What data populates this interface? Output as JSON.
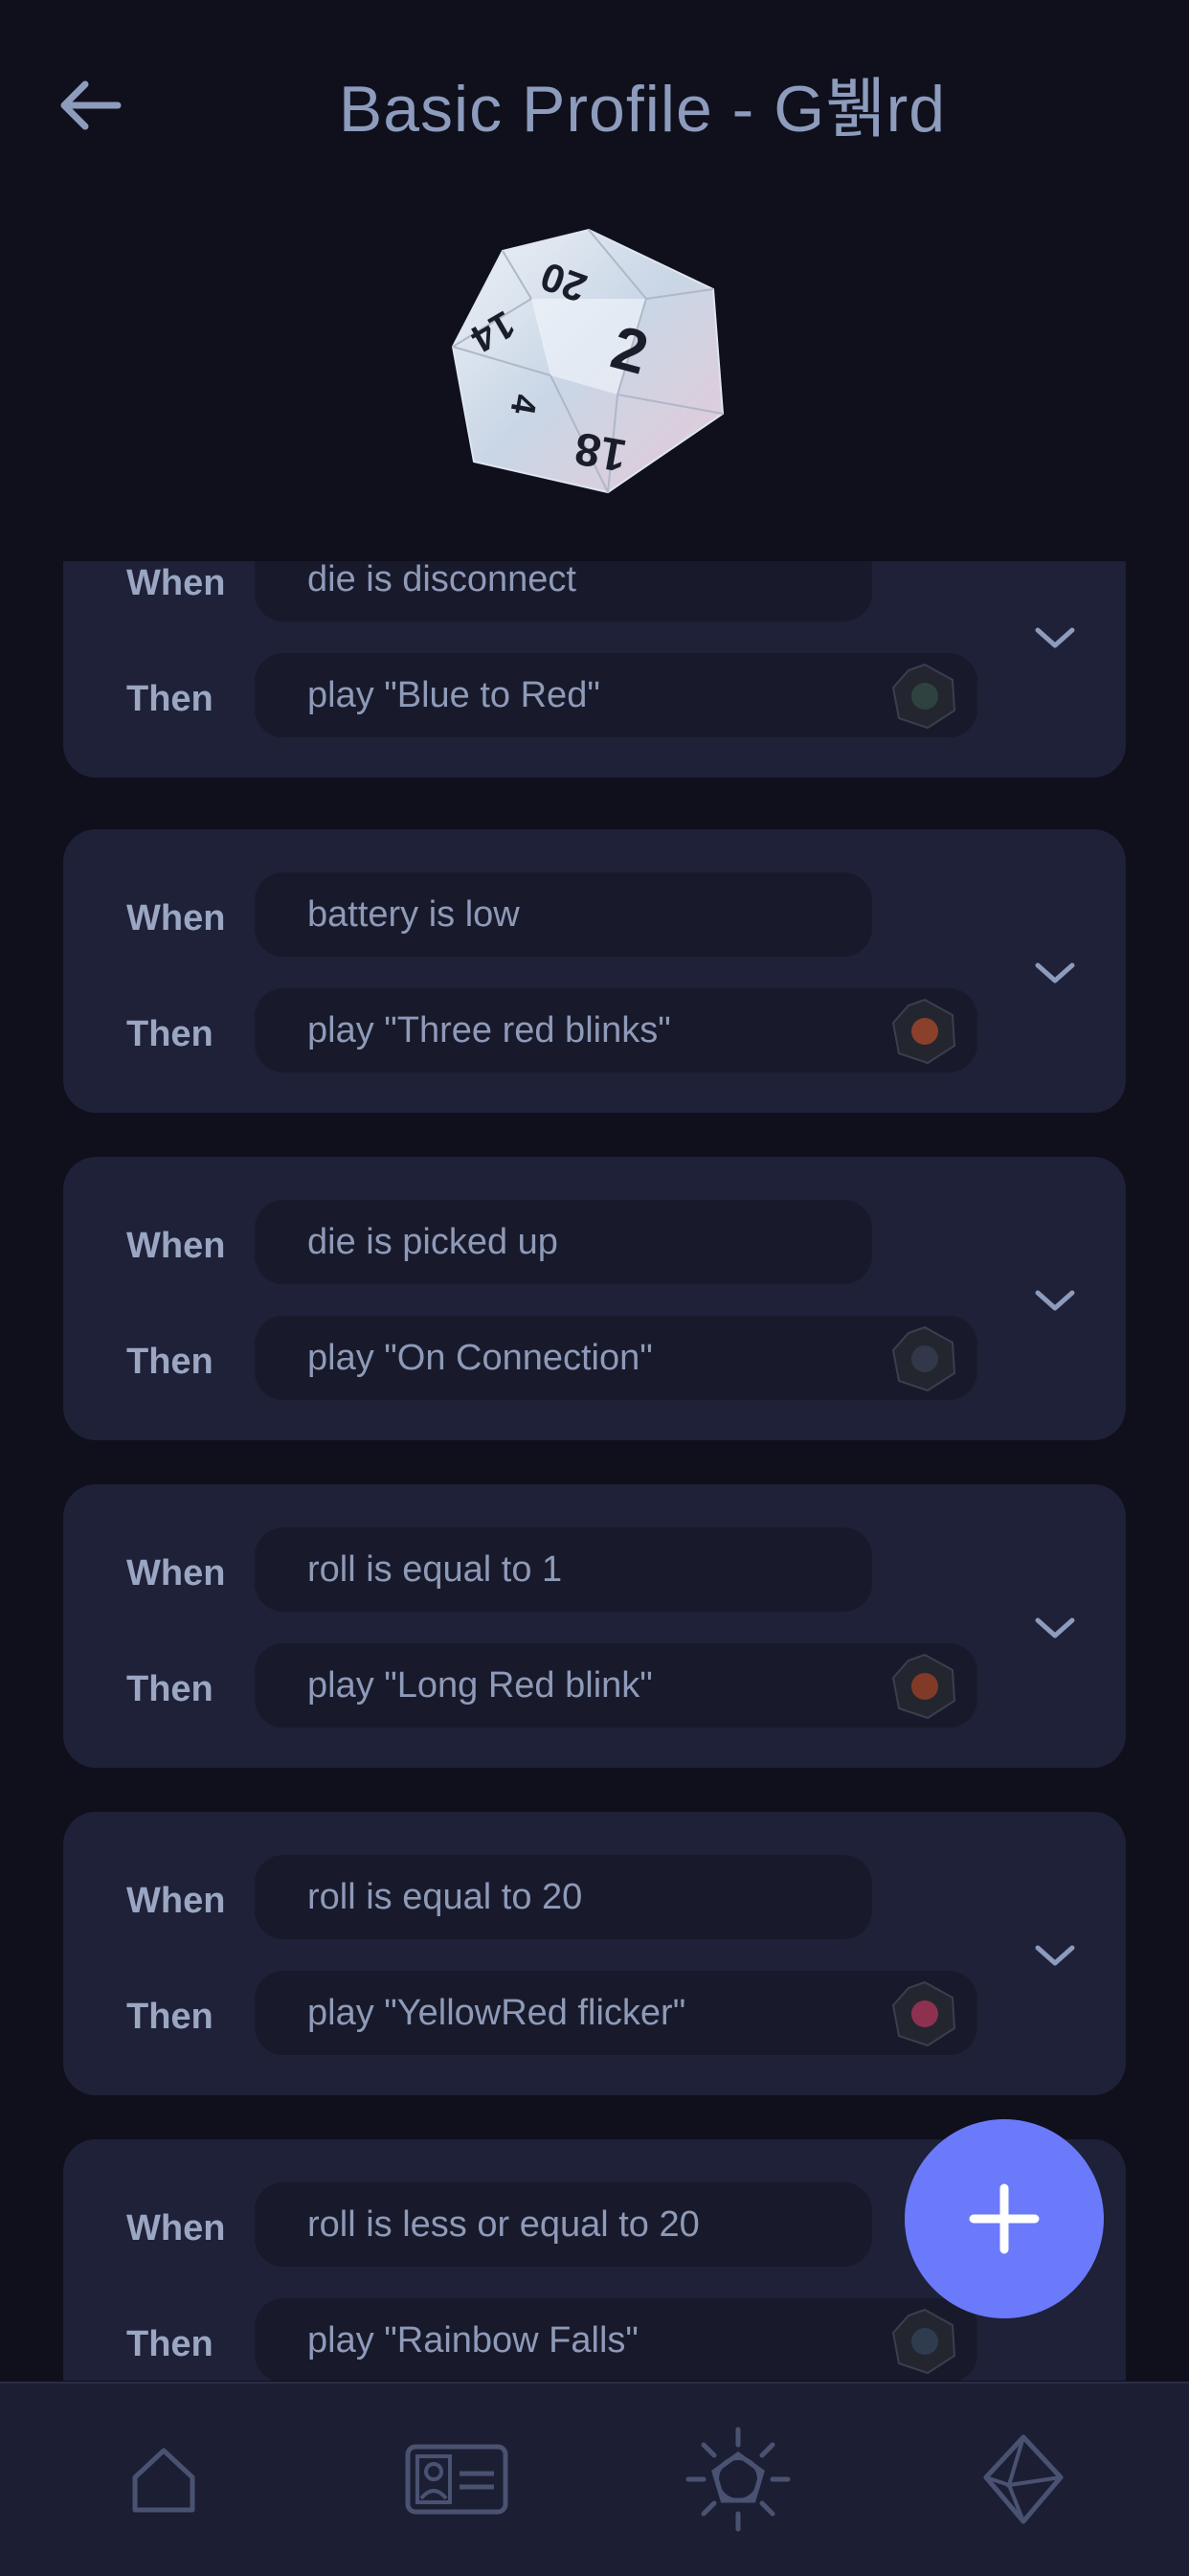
{
  "header": {
    "title": "Basic Profile - G뷁rd"
  },
  "rules": [
    {
      "when_label": "When",
      "then_label": "Then",
      "condition": "die is disconnect",
      "action": "play \"Blue to Red\"",
      "die_color": "#3a5a4f"
    },
    {
      "when_label": "When",
      "then_label": "Then",
      "condition": "battery is low",
      "action": "play \"Three red blinks\"",
      "die_color": "#e2562a"
    },
    {
      "when_label": "When",
      "then_label": "Then",
      "condition": "die is picked up",
      "action": "play \"On Connection\"",
      "die_color": "#3f4760"
    },
    {
      "when_label": "When",
      "then_label": "Then",
      "condition": "roll is equal to 1",
      "action": "play \"Long Red blink\"",
      "die_color": "#d24a22"
    },
    {
      "when_label": "When",
      "then_label": "Then",
      "condition": "roll is equal to 20",
      "action": "play \"YellowRed flicker\"",
      "die_color": "#e83a6c"
    },
    {
      "when_label": "When",
      "then_label": "Then",
      "condition": "roll is less or equal to 20",
      "action": "play \"Rainbow Falls\"",
      "die_color": "#3a4f6a"
    }
  ],
  "nav": {
    "items": [
      {
        "icon": "home-icon"
      },
      {
        "icon": "profile-card-icon"
      },
      {
        "icon": "animation-icon"
      },
      {
        "icon": "dice-icon"
      }
    ]
  },
  "colors": {
    "background": "#0f101c",
    "card": "#1e2137",
    "pill": "#181a2b",
    "accent": "#6b79fb",
    "text": "#9aa6c2"
  }
}
